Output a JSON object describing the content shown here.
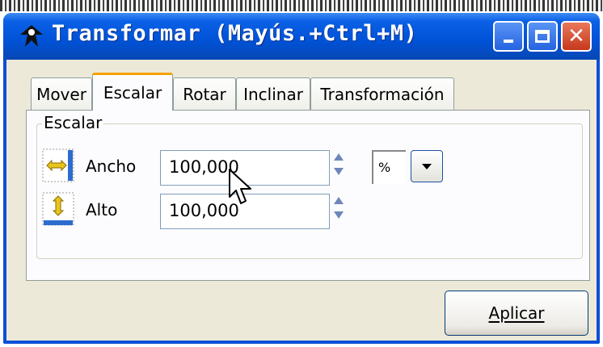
{
  "window": {
    "title": "Transformar (Mayús.+Ctrl+M)",
    "controls": {
      "minimize": "minimize",
      "maximize": "maximize",
      "close": "✕"
    }
  },
  "tabs": [
    {
      "label": "Mover",
      "active": false
    },
    {
      "label": "Escalar",
      "active": true
    },
    {
      "label": "Rotar",
      "active": false
    },
    {
      "label": "Inclinar",
      "active": false
    },
    {
      "label": "Transformación",
      "active": false
    }
  ],
  "scale_group": {
    "label": "Escalar",
    "width": {
      "label": "Ancho",
      "value": "100,000",
      "icon": "scale-width-icon"
    },
    "height": {
      "label": "Alto",
      "value": "100,000",
      "icon": "scale-height-icon"
    },
    "unit": "%"
  },
  "apply_button": {
    "label": "Aplicar"
  },
  "colors": {
    "titlebar": "#0052d6",
    "window_bg": "#ece9d8",
    "tab_accent": "#f4a000",
    "close_button": "#c7381c"
  }
}
